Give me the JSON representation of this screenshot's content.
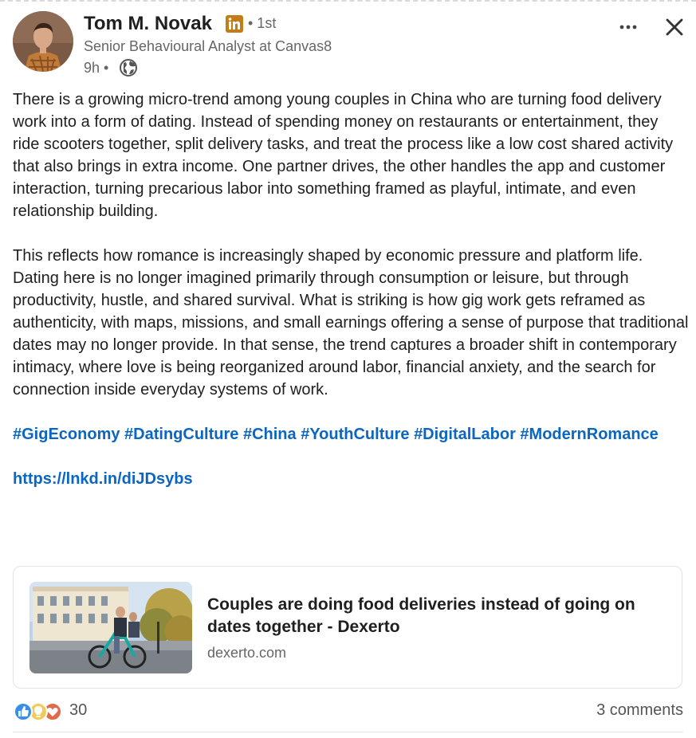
{
  "author": {
    "name": "Tom M. Novak",
    "degree": "• 1st",
    "headline": "Senior Behavioural Analyst  at Canvas8",
    "time": "9h •",
    "badge_text": "in"
  },
  "menu": {
    "more_label": "•••"
  },
  "post": {
    "paragraph1": "There is a growing micro-trend among young couples in China who are turning food delivery work into a form of dating. Instead of spending money on restaurants or entertainment, they ride scooters together, split delivery tasks, and treat the process like a low cost shared activity that also brings in extra income. One partner drives, the other handles the app and customer interaction, turning precarious labor into something framed as playful, intimate, and even relationship building.",
    "paragraph2": "This reflects how romance is increasingly shaped by economic pressure and platform life. Dating here is no longer imagined primarily through consumption or leisure, but through productivity, hustle, and shared survival. What is striking is how gig work gets reframed as authenticity, with maps, missions, and small earnings offering a sense of purpose that traditional dates may no longer provide. In that sense, the trend captures a broader shift in contemporary intimacy, where love is being reorganized around labor, financial anxiety, and the search for connection inside everyday systems of work.",
    "hashtags": [
      "#GigEconomy",
      "#DatingCulture",
      "#China",
      "#YouthCulture",
      "#DigitalLabor",
      "#ModernRomance"
    ],
    "link": "https://lnkd.in/diJDsybs"
  },
  "card": {
    "title": "Couples are doing food deliveries instead of going on dates together - Dexerto",
    "source": "dexerto.com"
  },
  "social": {
    "reaction_count": "30",
    "comments": "3 comments",
    "reaction_icons": [
      "like-icon",
      "insightful-icon",
      "love-icon"
    ]
  },
  "colors": {
    "link_blue": "#0a66c2",
    "linkedin_badge": "#c37d16",
    "text_primary": "#1f1f1f",
    "text_secondary": "#666666"
  }
}
